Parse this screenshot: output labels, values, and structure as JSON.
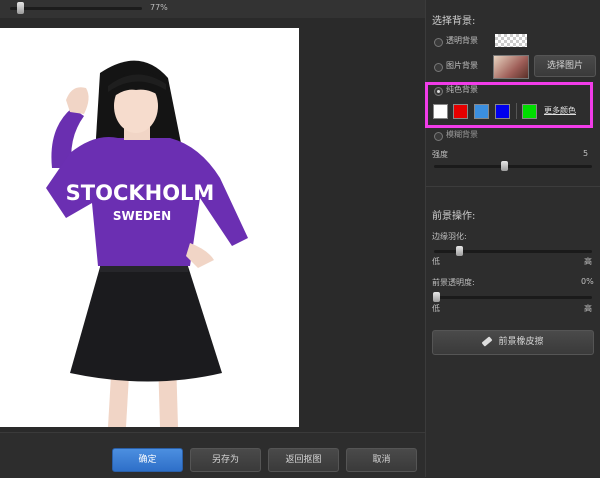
{
  "zoom": {
    "value_label": "77%",
    "level": 0.77
  },
  "buttons": {
    "ok": "确定",
    "save_as": "另存为",
    "back": "返回抠图",
    "cancel": "取消"
  },
  "panel": {
    "bg_title": "选择背景:",
    "transparent_bg": "透明背景",
    "image_bg": "图片背景",
    "choose_image": "选择图片",
    "solid_bg": "纯色背景",
    "swatches": [
      "#ffffff",
      "#e60000",
      "#3b8fe0",
      "#0000ee",
      "#00dd00"
    ],
    "more_colors": "更多颜色",
    "blur_bg": "模糊背景",
    "strength_label": "强度",
    "strength_value": "5",
    "fg_title": "前景操作:",
    "feather_label": "边缘羽化:",
    "low": "低",
    "high": "高",
    "opacity_label": "前景透明度:",
    "opacity_value": "0%",
    "eraser_button": "前景橡皮擦"
  },
  "photo": {
    "shirt_text_1": "STOCKHOLM",
    "shirt_text_2": "SWEDEN"
  },
  "colors": {
    "highlight": "#f13ce8",
    "primary": "#3a7bd5"
  }
}
